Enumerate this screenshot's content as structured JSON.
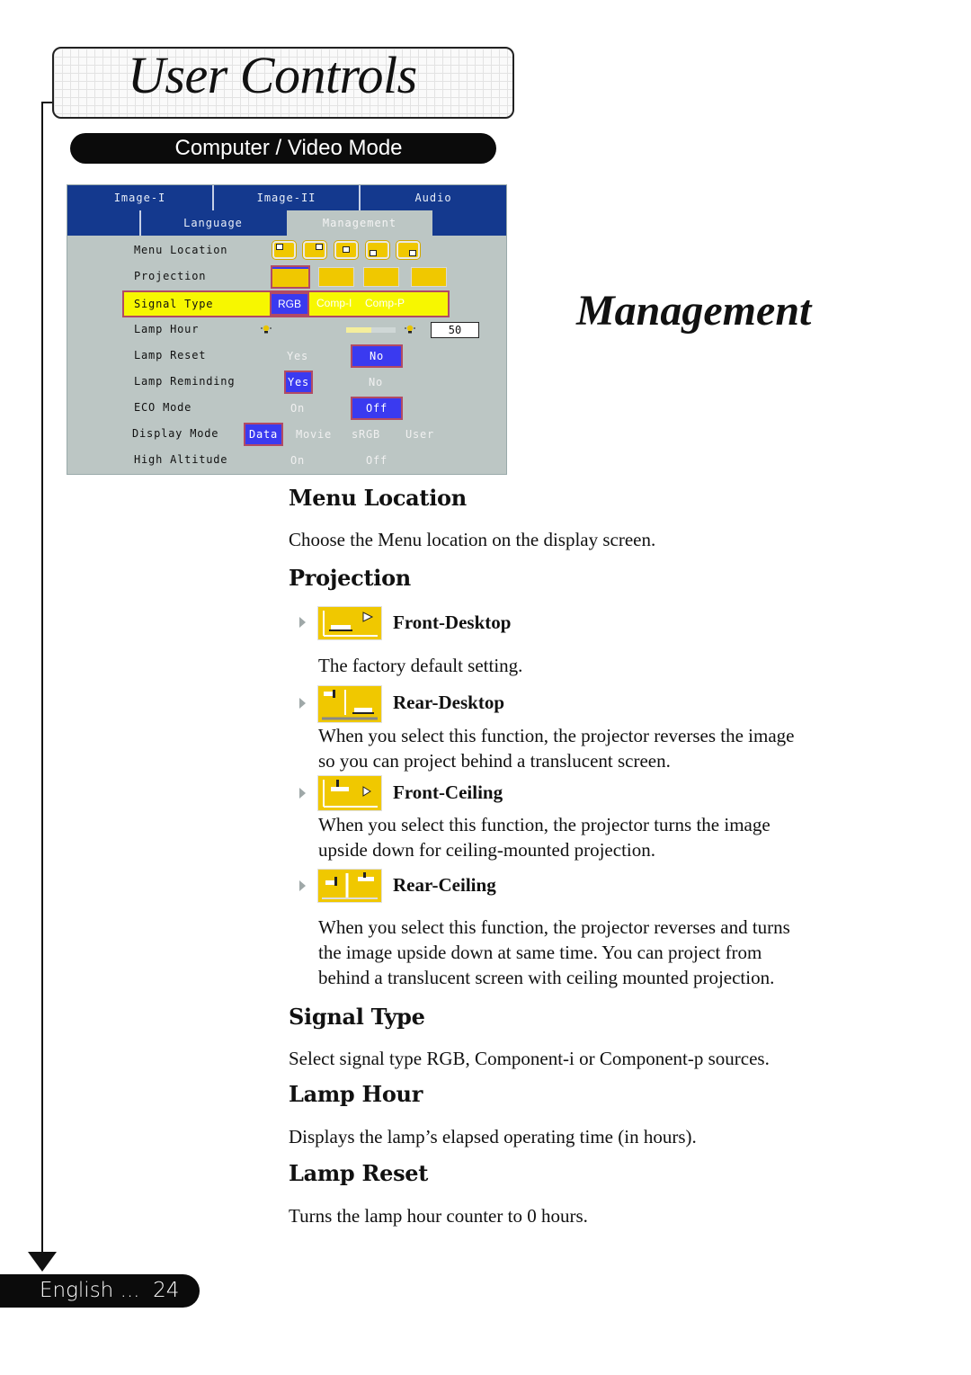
{
  "header": {
    "title": "User Controls",
    "mode_banner": "Computer / Video Mode"
  },
  "osd": {
    "tabs_row1": [
      "Image-I",
      "Image-II",
      "Audio"
    ],
    "tabs_row2": [
      "Language",
      "Management"
    ],
    "active_tab": "Management",
    "rows": [
      {
        "label": "Menu Location",
        "type": "icons",
        "icons": [
          "top-left",
          "top-right",
          "center",
          "bottom-left",
          "bottom-right"
        ]
      },
      {
        "label": "Projection",
        "type": "icons",
        "icons": [
          "front-desktop",
          "rear-desktop",
          "front-ceiling",
          "rear-ceiling"
        ],
        "selected": "front-desktop"
      },
      {
        "label": "Signal Type",
        "type": "options",
        "options": [
          "RGB",
          "Comp-I",
          "Comp-P"
        ],
        "selected": "RGB"
      },
      {
        "label": "Lamp Hour",
        "type": "meter",
        "value": "50",
        "fill_fraction": 0.5
      },
      {
        "label": "Lamp Reset",
        "type": "options",
        "options": [
          "Yes",
          "No"
        ],
        "selected": "No"
      },
      {
        "label": "Lamp Reminding",
        "type": "options",
        "options": [
          "Yes",
          "No"
        ],
        "selected": "Yes"
      },
      {
        "label": "ECO Mode",
        "type": "options",
        "options": [
          "On",
          "Off"
        ],
        "selected": "Off"
      },
      {
        "label": "Display Mode",
        "type": "options",
        "options": [
          "Data",
          "Movie",
          "sRGB",
          "User"
        ],
        "selected": "Data"
      },
      {
        "label": "High Altitude",
        "type": "options",
        "options": [
          "On",
          "Off"
        ],
        "selected": null
      }
    ]
  },
  "section_title": "Management",
  "sections": {
    "menu_location": {
      "heading": "Menu Location",
      "text": "Choose the Menu location on the display screen."
    },
    "projection": {
      "heading": "Projection",
      "items": [
        {
          "icon": "front-desktop-icon",
          "label": "Front-Desktop",
          "text": "The factory default setting."
        },
        {
          "icon": "rear-desktop-icon",
          "label": "Rear-Desktop",
          "text_lines": [
            "When you select this function, the projector reverses the image",
            "so you can project behind a translucent screen."
          ]
        },
        {
          "icon": "front-ceiling-icon",
          "label": "Front-Ceiling",
          "text_lines": [
            "When you select this function, the projector turns the image",
            "upside down for ceiling-mounted projection."
          ]
        },
        {
          "icon": "rear-ceiling-icon",
          "label": "Rear-Ceiling",
          "text_lines": [
            "When you select this function, the projector reverses and turns",
            "the image upside down at same time. You can project from",
            "behind a translucent screen with ceiling mounted projection."
          ]
        }
      ]
    },
    "signal_type": {
      "heading": "Signal Type",
      "text": "Select signal type RGB, Component-i or Component-p sources."
    },
    "lamp_hour": {
      "heading": "Lamp Hour",
      "text": "Displays the lamp’s elapsed operating time (in hours)."
    },
    "lamp_reset": {
      "heading": "Lamp Reset",
      "text": "Turns the lamp hour counter to 0 hours."
    }
  },
  "footer": {
    "language": "English ...",
    "page_number": "24",
    "label": "English ...  24"
  },
  "colors": {
    "osd_blue": "#14398e",
    "osd_panel": "#bcc6c4",
    "osd_select": "#3a3af0",
    "osd_highlight": "#f7f700",
    "osd_border": "#b24a64",
    "icon_yellow": "#f0c800"
  }
}
